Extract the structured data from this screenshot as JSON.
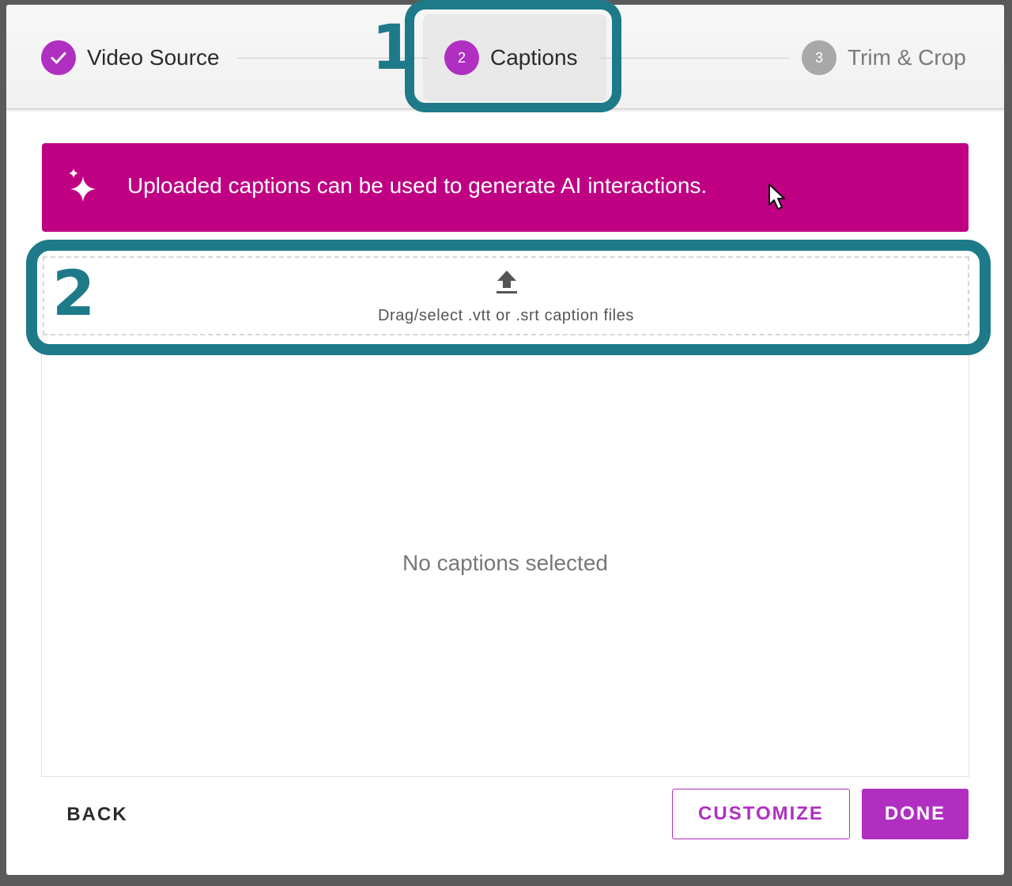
{
  "stepper": {
    "steps": [
      {
        "number": "",
        "label": "Video Source",
        "state": "complete",
        "icon": "check-icon"
      },
      {
        "number": "2",
        "label": "Captions",
        "state": "active"
      },
      {
        "number": "3",
        "label": "Trim & Crop",
        "state": "pending"
      }
    ]
  },
  "banner": {
    "icon": "sparkle-icon",
    "text": "Uploaded captions can be used to generate AI interactions."
  },
  "dropzone": {
    "icon": "upload-icon",
    "text": "Drag/select .vtt or .srt caption files"
  },
  "captions_list": {
    "empty_text": "No captions selected"
  },
  "footer": {
    "back_label": "BACK",
    "customize_label": "CUSTOMIZE",
    "done_label": "DONE"
  },
  "annotations": {
    "callout_1": "1",
    "callout_2": "2"
  },
  "colors": {
    "accent": "#b02fc1",
    "banner": "#bf0083",
    "annotation": "#1e7a88",
    "pending": "#a8a8a8"
  }
}
